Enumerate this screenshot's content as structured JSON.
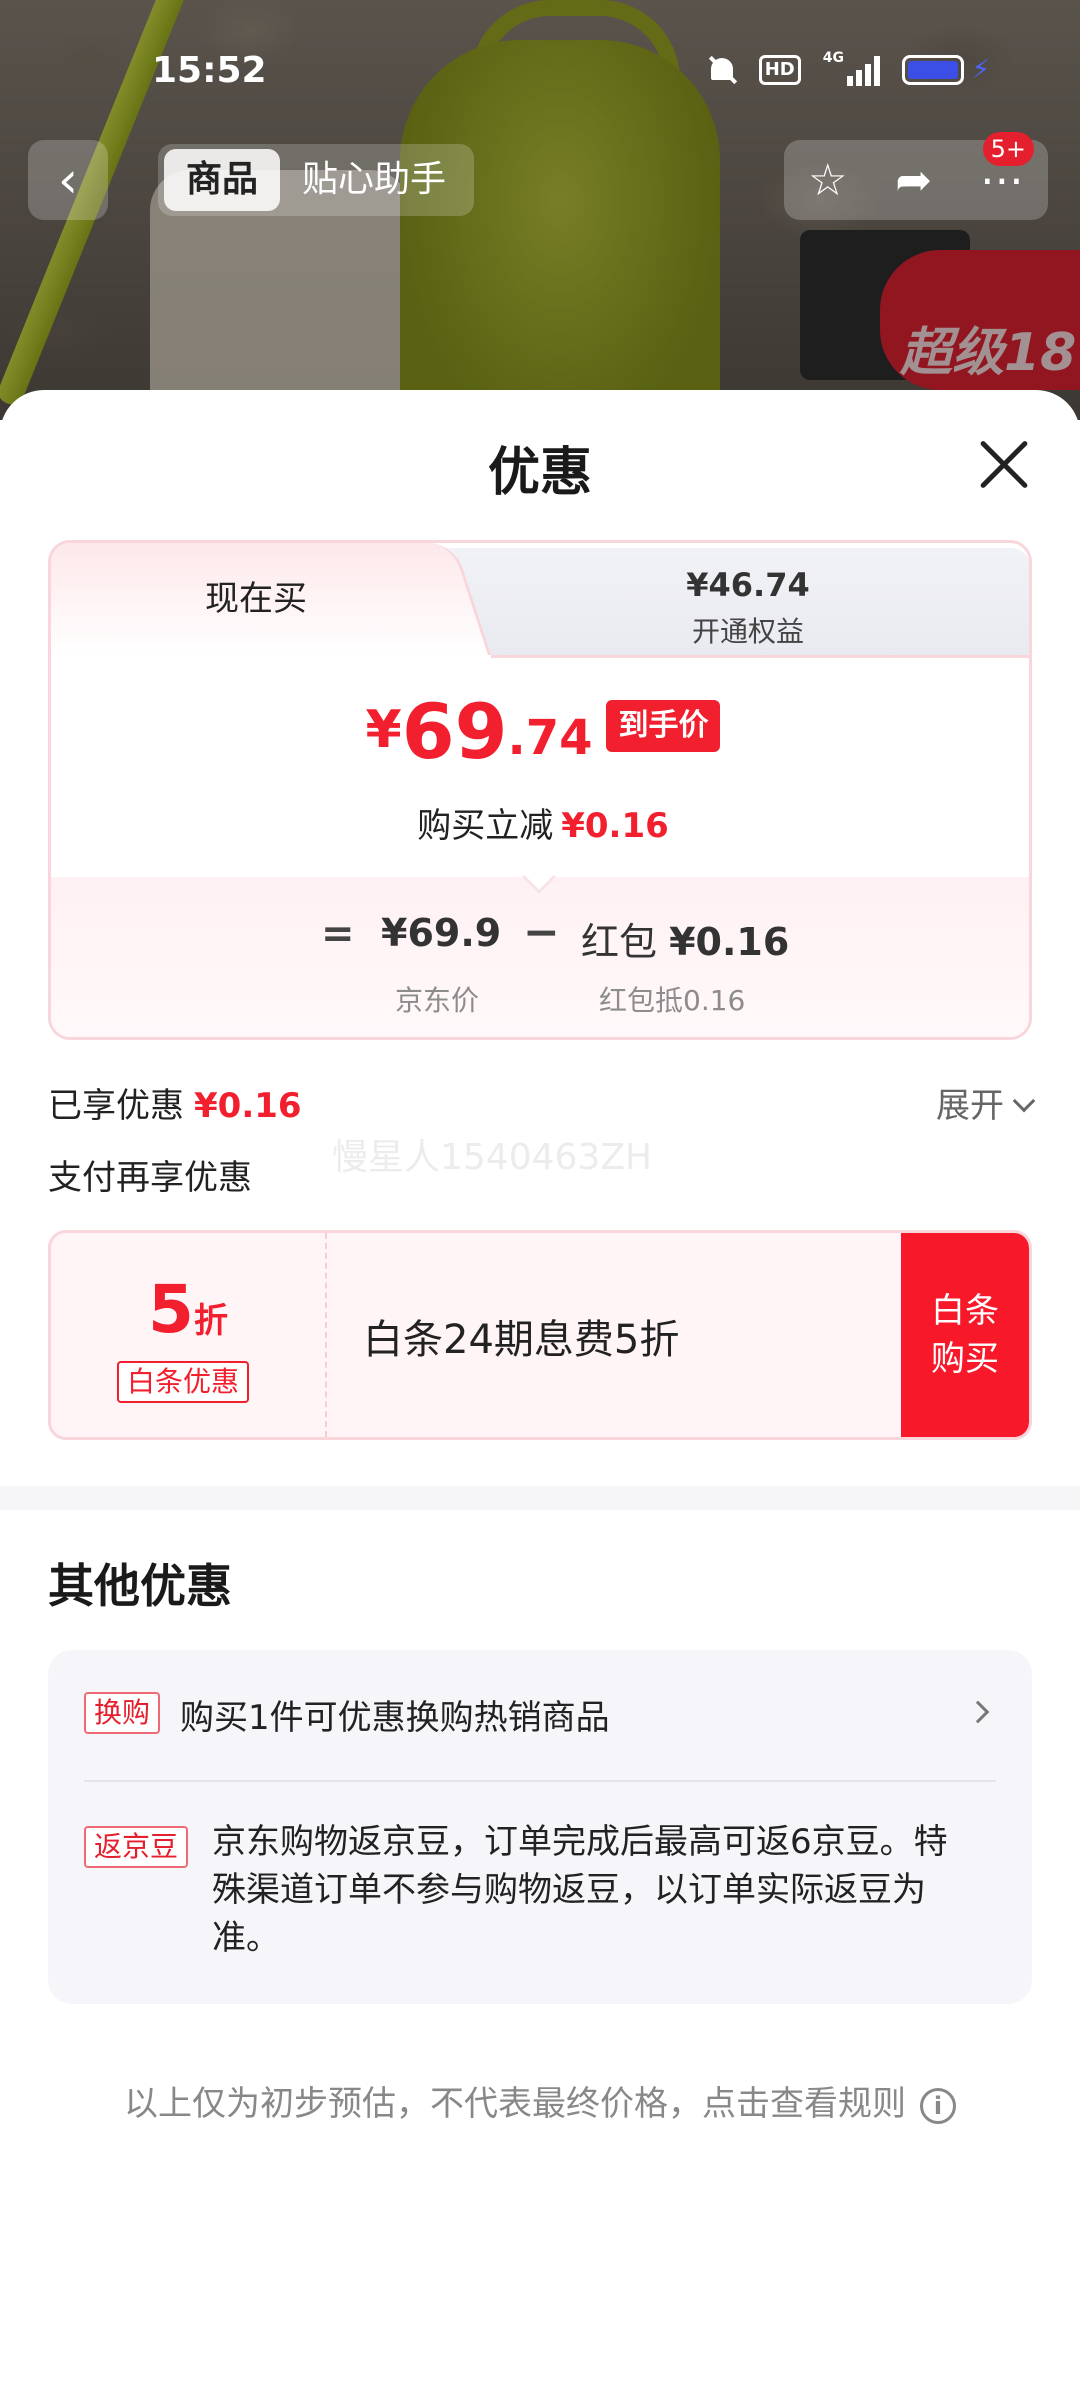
{
  "status_bar": {
    "time": "15:52",
    "hd_label": "HD",
    "network": "4G",
    "icons": [
      "bell-muted-icon",
      "hd-icon",
      "signal-icon",
      "battery-icon",
      "charging-icon"
    ]
  },
  "nav": {
    "tabs": [
      {
        "label": "商品",
        "active": true
      },
      {
        "label": "贴心助手",
        "active": false
      }
    ],
    "badge": "5+",
    "icons": [
      "back-arrow-icon",
      "star-icon",
      "share-icon",
      "more-icon"
    ]
  },
  "photo": {
    "promo_text": "超级18"
  },
  "sheet": {
    "title": "优惠",
    "tabs": {
      "left_label": "现在买",
      "right_value": "¥46.74",
      "right_label": "开通权益"
    },
    "final_price": {
      "currency": "¥",
      "integer": "69",
      "decimal": ".74",
      "tag": "到手价"
    },
    "instant": {
      "label": "购买立减",
      "amount": "¥0.16"
    },
    "calc": {
      "eq": "=",
      "base_price": "¥69.9",
      "minus": "−",
      "redpacket_label": "红包",
      "redpacket_amount": "¥0.16",
      "base_caption": "京东价",
      "redpacket_caption": "红包抵0.16"
    },
    "enjoyed": {
      "label": "已享优惠",
      "amount": "¥0.16",
      "expand": "展开"
    },
    "watermark": "慢星人1540463ZH",
    "pay_more": "支付再享优惠",
    "coupon": {
      "rate": "5",
      "unit": "折",
      "tag": "白条优惠",
      "desc": "白条24期息费5折",
      "button_line1": "白条",
      "button_line2": "购买"
    },
    "other": {
      "title": "其他优惠",
      "items": [
        {
          "tag": "换购",
          "text": "购买1件可优惠换购热销商品"
        },
        {
          "tag": "返京豆",
          "text": "京东购物返京豆，订单完成后最高可返6京豆。特殊渠道订单不参与购物返豆，以订单实际返豆为准。"
        }
      ]
    },
    "disclaimer": "以上仅为初步预估，不代表最终价格，点击查看规则"
  },
  "colors": {
    "accent_red": "#f2202e",
    "tag_border": "#f8d6db"
  }
}
